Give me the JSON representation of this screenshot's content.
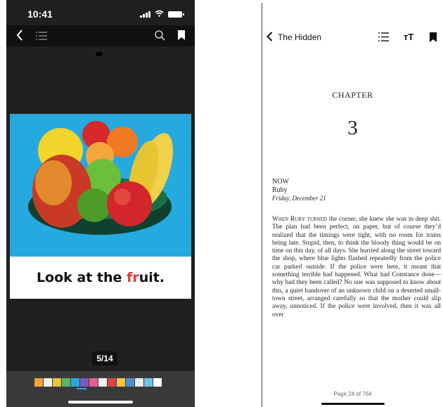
{
  "left_phone": {
    "status_bar": {
      "time": "10:41"
    },
    "toolbar": {
      "back_icon": "chevron-left-icon",
      "toc_icon": "list-icon",
      "search_icon": "search-icon",
      "bookmark_icon": "bookmark-icon"
    },
    "page": {
      "caption_before": "Look at the ",
      "caption_highlight": "fr",
      "caption_after": "uit.",
      "image": "fruit-bowl-illustration"
    },
    "page_indicator": "5/14",
    "colors": {
      "page_background": "#26a9de",
      "highlight": "#e43a3a"
    }
  },
  "right_phone": {
    "toolbar": {
      "back_label": "The Hidden",
      "toc_icon": "list-icon",
      "text_size_label": "тT",
      "bookmark_icon": "bookmark-icon"
    },
    "chapter_label": "CHAPTER",
    "chapter_number": "3",
    "section": "NOW",
    "character": "Ruby",
    "date": "Friday, December 21",
    "body_lead": "When Ruby turned",
    "body": " the corner, she knew she was in deep shit. The plan had been perfect, on paper, but of course they’d realized that the timings were tight, with no room for trains being late. Stupid, then, to think the bloody thing would be on time on this day, of all days. She hurried along the street toward the shop, where blue lights flashed repeatedly from the police car parked outside. If the police were here, it meant that something terrible had happened. What had Constance done—why had they been called? No one was supposed to know about this, a quiet handover of an unknown child on a deserted small-town street, arranged carefully so that the mother could slip away, unnoticed. If the police were involved, then it was all over",
    "page_number": "Page 24 of 764"
  }
}
